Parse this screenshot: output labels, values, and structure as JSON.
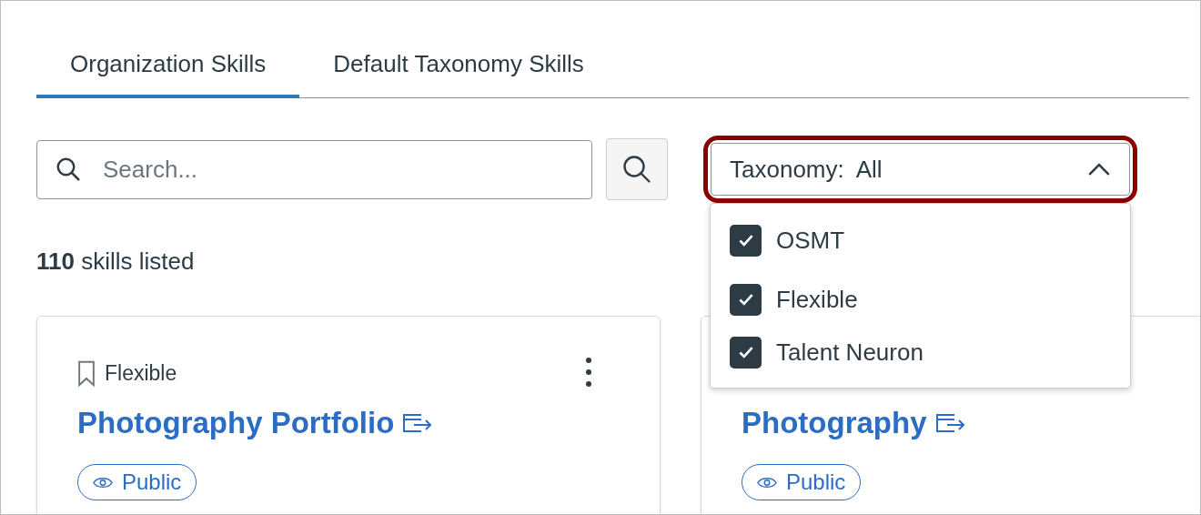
{
  "tabs": [
    {
      "label": "Organization Skills",
      "selected": true
    },
    {
      "label": "Default Taxonomy Skills",
      "selected": false
    }
  ],
  "search": {
    "placeholder": "Search..."
  },
  "taxonomy_filter": {
    "label": "Taxonomy:",
    "value": "All",
    "expanded": true,
    "highlighted": true,
    "options": [
      {
        "label": "OSMT",
        "checked": true
      },
      {
        "label": "Flexible",
        "checked": true
      },
      {
        "label": "Talent Neuron",
        "checked": true
      }
    ]
  },
  "summary": {
    "count": "110",
    "text": "skills listed"
  },
  "cards": [
    {
      "tag": "Flexible",
      "title": "Photography Portfolio",
      "visibility": "Public",
      "has_menu": true
    },
    {
      "title": "Photography",
      "visibility": "Public"
    }
  ]
}
